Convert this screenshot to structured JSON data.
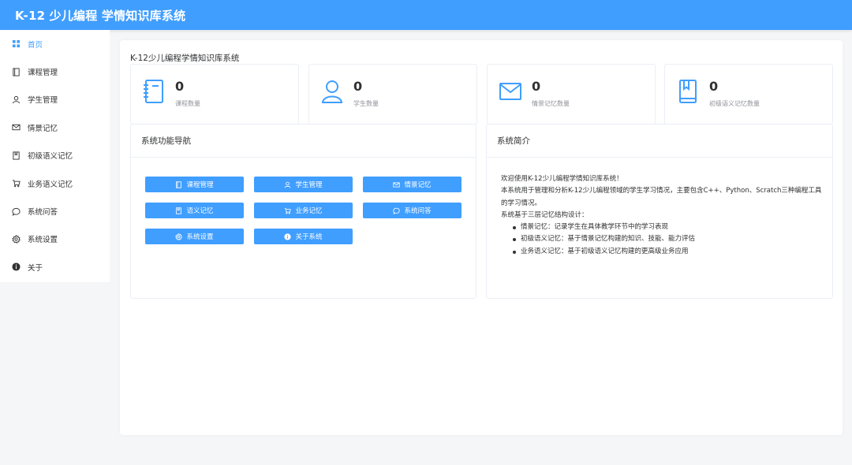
{
  "app": {
    "title": "K-12 少儿编程 学情知识库系统"
  },
  "sidebar": {
    "items": [
      {
        "label": "首页",
        "icon": "grid-icon",
        "active": true
      },
      {
        "label": "课程管理",
        "icon": "notebook-icon"
      },
      {
        "label": "学生管理",
        "icon": "user-icon"
      },
      {
        "label": "情景记忆",
        "icon": "mail-icon"
      },
      {
        "label": "初级语义记忆",
        "icon": "bookmark-book-icon"
      },
      {
        "label": "业务语义记忆",
        "icon": "cart-icon"
      },
      {
        "label": "系统问答",
        "icon": "chat-icon"
      },
      {
        "label": "系统设置",
        "icon": "gear-icon"
      },
      {
        "label": "关于",
        "icon": "info-icon"
      }
    ]
  },
  "main": {
    "heading": "K-12少儿编程学情知识库系统",
    "stats": [
      {
        "value": "0",
        "label": "课程数量",
        "icon": "notebook-icon"
      },
      {
        "value": "0",
        "label": "学生数量",
        "icon": "user-icon"
      },
      {
        "value": "0",
        "label": "情景记忆数量",
        "icon": "mail-icon"
      },
      {
        "value": "0",
        "label": "初级语义记忆数量",
        "icon": "bookmark-book-icon"
      }
    ],
    "nav_panel": {
      "title": "系统功能导航",
      "buttons": [
        {
          "label": "课程管理",
          "icon": "notebook-icon"
        },
        {
          "label": "学生管理",
          "icon": "user-icon"
        },
        {
          "label": "情景记忆",
          "icon": "mail-icon"
        },
        {
          "label": "语义记忆",
          "icon": "bookmark-book-icon"
        },
        {
          "label": "业务记忆",
          "icon": "cart-icon"
        },
        {
          "label": "系统问答",
          "icon": "chat-icon"
        },
        {
          "label": "系统设置",
          "icon": "gear-icon"
        },
        {
          "label": "关于系统",
          "icon": "info-icon"
        }
      ]
    },
    "intro_panel": {
      "title": "系统简介",
      "welcome": "欢迎使用K-12少儿编程学情知识库系统！",
      "description": "本系统用于管理和分析K-12少儿编程领域的学生学习情况，主要包含C++、Python、Scratch三种编程工具的学习情况。",
      "architecture_intro": "系统基于三层记忆结构设计：",
      "bullets": [
        "情景记忆：记录学生在具体教学环节中的学习表现",
        "初级语义记忆：基于情景记忆构建的知识、技能、能力评估",
        "业务语义记忆：基于初级语义记忆构建的更高级业务应用"
      ]
    }
  },
  "colors": {
    "primary": "#409eff",
    "text": "#303133",
    "muted": "#909399",
    "border": "#ebeef5",
    "bg": "#f5f6f8"
  }
}
